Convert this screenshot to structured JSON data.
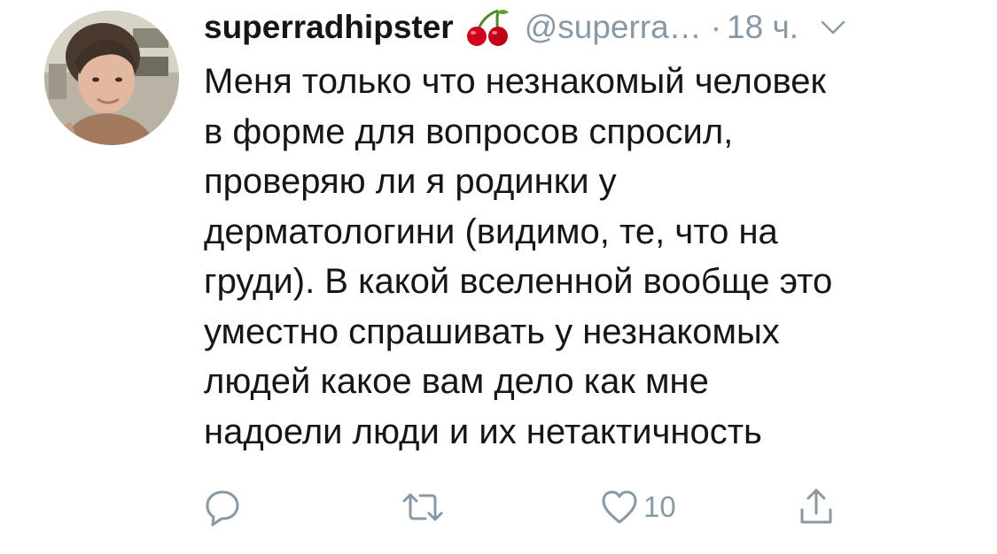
{
  "tweet": {
    "display_name": "superradhipster",
    "name_emoji": "cherries-emoji",
    "handle": "@superra…",
    "separator": "·",
    "time": "18 ч.",
    "text_lines": [
      "Меня только что незнакомый человек",
      "в форме для вопросов спросил,",
      "проверяю ли я родинки у",
      "дерматологини (видимо, те, что на",
      "груди). В какой вселенной вообще это",
      "уместно спрашивать у незнакомых",
      "людей какое вам дело как мне",
      "надоели люди и их нетактичность"
    ],
    "actions": {
      "reply_icon": "reply-icon",
      "retweet_icon": "retweet-icon",
      "like_icon": "heart-icon",
      "like_count": "10",
      "share_icon": "share-icon"
    }
  },
  "colors": {
    "text": "#14171a",
    "secondary": "#8899a6",
    "background": "#ffffff",
    "cherry": "#d0021b"
  }
}
